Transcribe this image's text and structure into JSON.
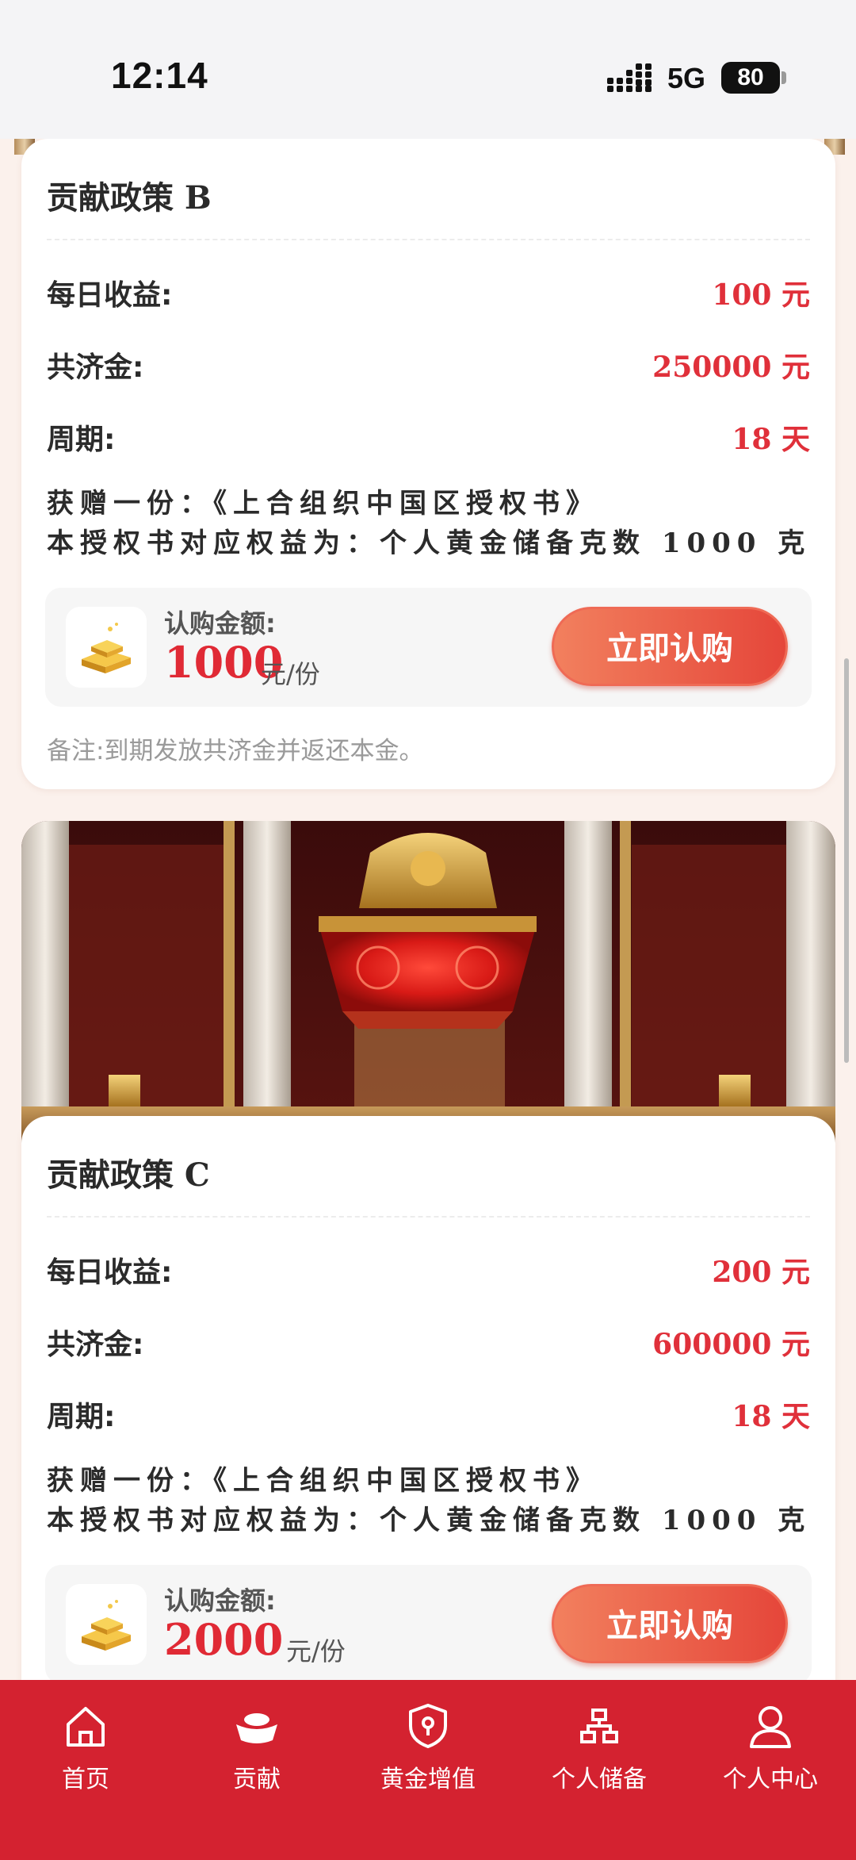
{
  "status_bar": {
    "time": "12:14",
    "network": "5G",
    "battery": "80"
  },
  "cards": [
    {
      "title": "贡献政策 B",
      "rows": [
        {
          "label": "每日收益:",
          "value": "100 元"
        },
        {
          "label": "共济金:",
          "value": "250000 元"
        },
        {
          "label": "周期:",
          "value": "18 天"
        }
      ],
      "gift_line1": "获赠一份：《上合组织中国区授权书》",
      "gift_line2": "本授权书对应权益为：个人黄金储备克数 1000 克",
      "buy_label": "认购金额:",
      "buy_amount": "1000",
      "buy_unit": "元/份",
      "buy_button": "立即认购",
      "note": "备注:到期发放共济金并返还本金。"
    },
    {
      "title": "贡献政策 C",
      "rows": [
        {
          "label": "每日收益:",
          "value": "200 元"
        },
        {
          "label": "共济金:",
          "value": "600000 元"
        },
        {
          "label": "周期:",
          "value": "18 天"
        }
      ],
      "gift_line1": "获赠一份：《上合组织中国区授权书》",
      "gift_line2": "本授权书对应权益为：个人黄金储备克数 1000 克",
      "buy_label": "认购金额:",
      "buy_amount": "2000",
      "buy_unit": "元/份",
      "buy_button": "立即认购"
    }
  ],
  "nav": [
    {
      "label": "首页",
      "icon": "home-icon"
    },
    {
      "label": "贡献",
      "icon": "gold-ingot-icon"
    },
    {
      "label": "黄金增值",
      "icon": "shield-location-icon"
    },
    {
      "label": "个人储备",
      "icon": "network-icon"
    },
    {
      "label": "个人中心",
      "icon": "user-icon"
    }
  ],
  "colors": {
    "accent": "#d42230",
    "value_red": "#e0303a",
    "button_start": "#f2805e",
    "button_end": "#e5463a"
  }
}
